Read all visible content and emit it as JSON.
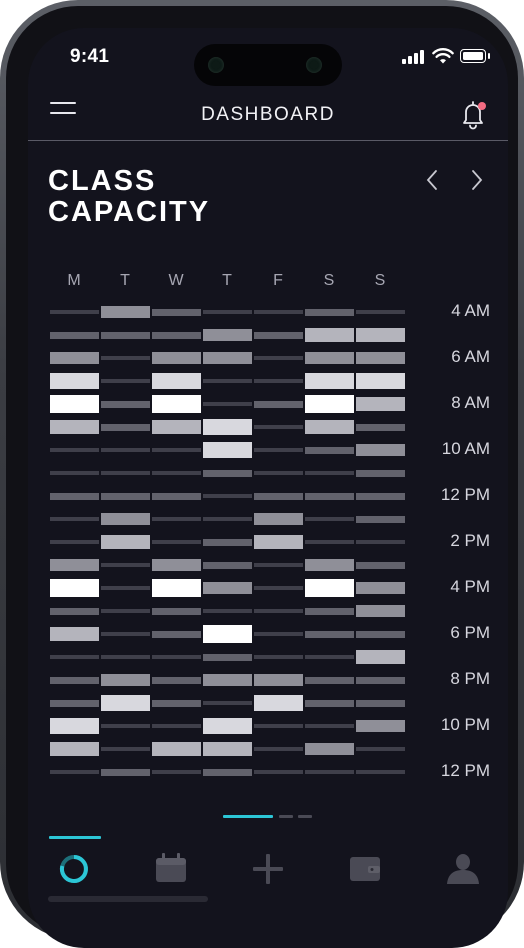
{
  "status_bar": {
    "time": "9:41"
  },
  "header": {
    "title": "DASHBOARD"
  },
  "page": {
    "title_line1": "CLASS",
    "title_line2": "CAPACITY"
  },
  "days": [
    "M",
    "T",
    "W",
    "T",
    "F",
    "S",
    "S"
  ],
  "time_labels": [
    "4 AM",
    "6 AM",
    "8 AM",
    "10 AM",
    "12 PM",
    "2 PM",
    "4 PM",
    "6 PM",
    "8 PM",
    "10 PM",
    "12 PM"
  ],
  "capacity_levels_note_free": true,
  "capacity_grid": [
    [
      1,
      3,
      2,
      1,
      1,
      2,
      1
    ],
    [
      2,
      2,
      2,
      3,
      2,
      4,
      4
    ],
    [
      3,
      1,
      3,
      3,
      1,
      3,
      3
    ],
    [
      5,
      1,
      5,
      1,
      1,
      5,
      5
    ],
    [
      6,
      2,
      6,
      1,
      2,
      6,
      4
    ],
    [
      4,
      2,
      4,
      5,
      1,
      4,
      2
    ],
    [
      1,
      1,
      1,
      5,
      1,
      2,
      3
    ],
    [
      1,
      1,
      1,
      2,
      1,
      1,
      2
    ],
    [
      2,
      2,
      2,
      1,
      2,
      2,
      2
    ],
    [
      1,
      3,
      1,
      1,
      3,
      1,
      2
    ],
    [
      1,
      4,
      1,
      2,
      4,
      1,
      1
    ],
    [
      3,
      1,
      3,
      2,
      1,
      3,
      2
    ],
    [
      6,
      1,
      6,
      3,
      1,
      6,
      3
    ],
    [
      2,
      1,
      2,
      1,
      1,
      2,
      3
    ],
    [
      4,
      1,
      2,
      6,
      1,
      2,
      2
    ],
    [
      1,
      1,
      1,
      2,
      1,
      1,
      4
    ],
    [
      2,
      3,
      2,
      3,
      3,
      2,
      2
    ],
    [
      2,
      5,
      2,
      1,
      5,
      2,
      2
    ],
    [
      5,
      1,
      1,
      5,
      1,
      1,
      3
    ],
    [
      4,
      1,
      4,
      4,
      1,
      3,
      1
    ],
    [
      1,
      2,
      1,
      2,
      1,
      1,
      1
    ]
  ],
  "pagination": {
    "pages": 3,
    "active": 0
  },
  "tabs": [
    "activity-ring-icon",
    "calendar-icon",
    "plus-icon",
    "wallet-icon",
    "profile-icon"
  ],
  "colors": {
    "background": "#13131d",
    "accent": "#2cc6d6",
    "notification": "#f36b82",
    "capacity_scale": [
      "#2b2b36",
      "#3f3f4a",
      "#62626c",
      "#8f8f98",
      "#b4b4bc",
      "#d8d8de",
      "#ffffff"
    ]
  }
}
